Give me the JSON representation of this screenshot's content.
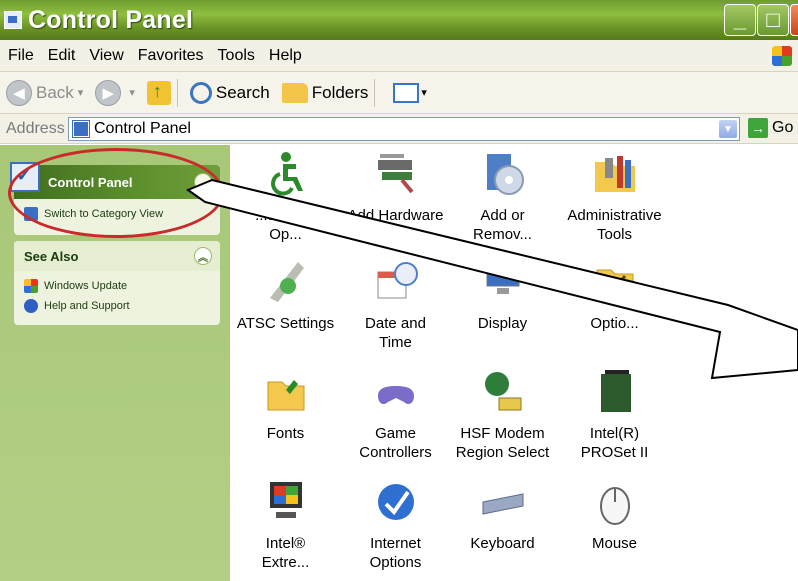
{
  "window": {
    "title": "Control Panel"
  },
  "menu": [
    "File",
    "Edit",
    "View",
    "Favorites",
    "Tools",
    "Help"
  ],
  "toolbar": {
    "back_label": "Back",
    "search_label": "Search",
    "folders_label": "Folders"
  },
  "address": {
    "label": "Address",
    "value": "Control Panel",
    "go_label": "Go"
  },
  "left_pane": {
    "control_panel_header": "Control Panel",
    "switch_view_link": "Switch to Category View",
    "see_also_header": "See Also",
    "see_also_links": [
      "Windows Update",
      "Help and Support"
    ]
  },
  "items": [
    {
      "line1": "...ssibility",
      "line2": "Op...",
      "icon": "accessibility-icon"
    },
    {
      "line1": "Add Hardware",
      "line2": "",
      "icon": "add-hardware-icon"
    },
    {
      "line1": "Add or",
      "line2": "Remov...",
      "icon": "add-remove-programs-icon"
    },
    {
      "line1": "Administrative",
      "line2": "Tools",
      "icon": "administrative-tools-icon"
    },
    {
      "line1": "ATSC Settings",
      "line2": "",
      "icon": "atsc-settings-icon"
    },
    {
      "line1": "Date and",
      "line2": "Time",
      "icon": "date-time-icon"
    },
    {
      "line1": "Display",
      "line2": "",
      "icon": "display-icon"
    },
    {
      "line1": "",
      "line2": "Optio...",
      "icon": "folder-options-icon"
    },
    {
      "line1": "Fonts",
      "line2": "",
      "icon": "fonts-icon"
    },
    {
      "line1": "Game",
      "line2": "Controllers",
      "icon": "game-controllers-icon"
    },
    {
      "line1": "HSF Modem",
      "line2": "Region Select",
      "icon": "modem-icon"
    },
    {
      "line1": "Intel(R)",
      "line2": "PROSet II",
      "icon": "intel-proset-icon"
    },
    {
      "line1": "Intel®",
      "line2": "Extre...",
      "icon": "intel-extreme-graphics-icon"
    },
    {
      "line1": "Internet",
      "line2": "Options",
      "icon": "internet-options-icon"
    },
    {
      "line1": "Keyboard",
      "line2": "",
      "icon": "keyboard-icon"
    },
    {
      "line1": "Mouse",
      "line2": "",
      "icon": "mouse-icon"
    }
  ],
  "colors": {
    "xp_olive_title": "#6f9b2f",
    "task_pane_green": "#a8c777",
    "highlight_red": "#cc2a2a"
  }
}
